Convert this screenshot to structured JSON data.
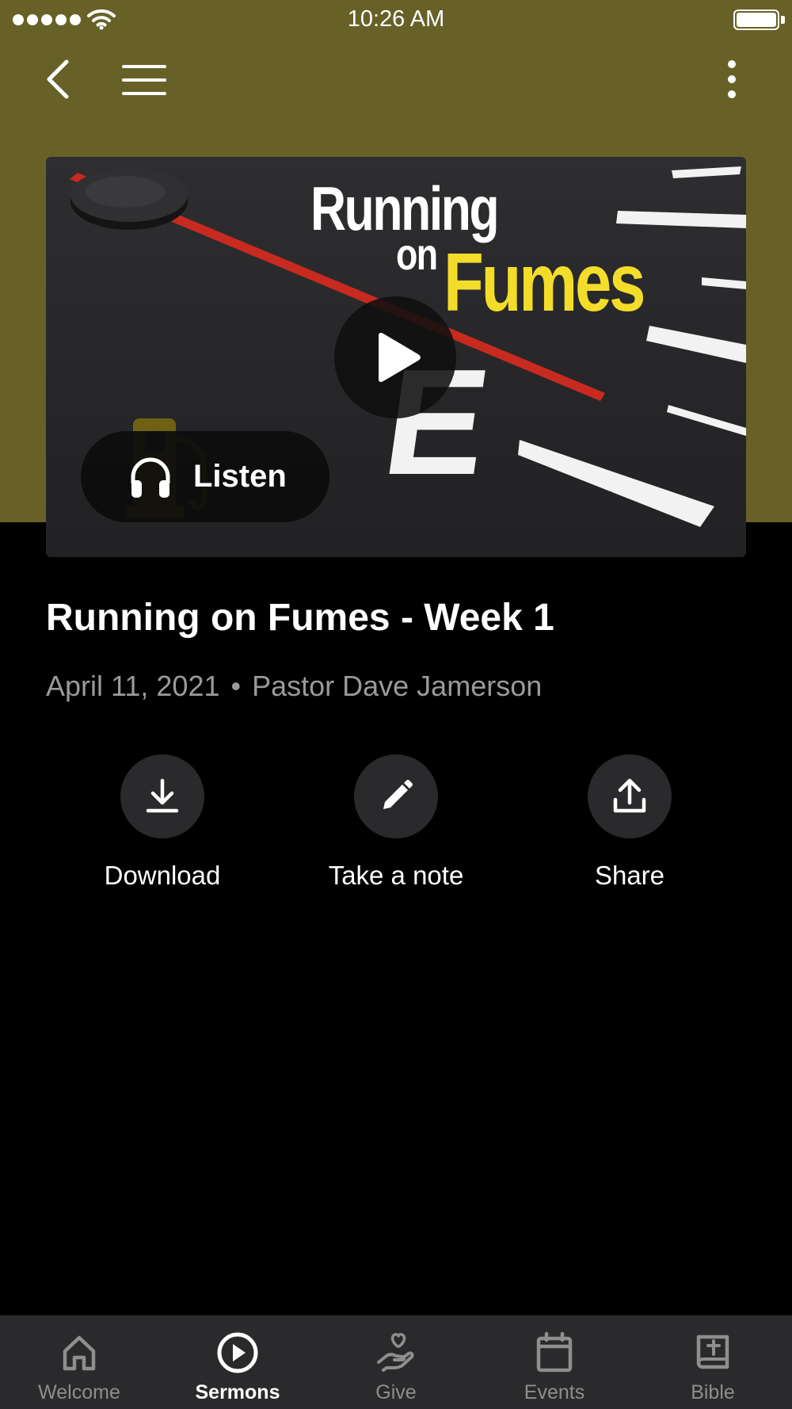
{
  "status_bar": {
    "time": "10:26 AM"
  },
  "artwork": {
    "title_line1": "Running",
    "title_line2": "on",
    "title_line3": "Fumes",
    "gauge_letter": "E",
    "listen_label": "Listen"
  },
  "sermon": {
    "title": "Running on Fumes - Week 1",
    "date": "April 11, 2021",
    "separator": "•",
    "speaker": "Pastor Dave Jamerson"
  },
  "actions": [
    {
      "label": "Download",
      "icon": "download-icon"
    },
    {
      "label": "Take a note",
      "icon": "pencil-icon"
    },
    {
      "label": "Share",
      "icon": "share-icon"
    }
  ],
  "tabs": [
    {
      "label": "Welcome",
      "icon": "home-icon",
      "active": false
    },
    {
      "label": "Sermons",
      "icon": "play-circle-icon",
      "active": true
    },
    {
      "label": "Give",
      "icon": "give-hand-heart-icon",
      "active": false
    },
    {
      "label": "Events",
      "icon": "calendar-icon",
      "active": false
    },
    {
      "label": "Bible",
      "icon": "bible-icon",
      "active": false
    }
  ],
  "colors": {
    "header_background": "#676128",
    "page_background": "#000000",
    "accent_yellow": "#f4dd2a",
    "tab_bar_background": "#2a2a2c",
    "muted_text": "#9a9a9a"
  }
}
